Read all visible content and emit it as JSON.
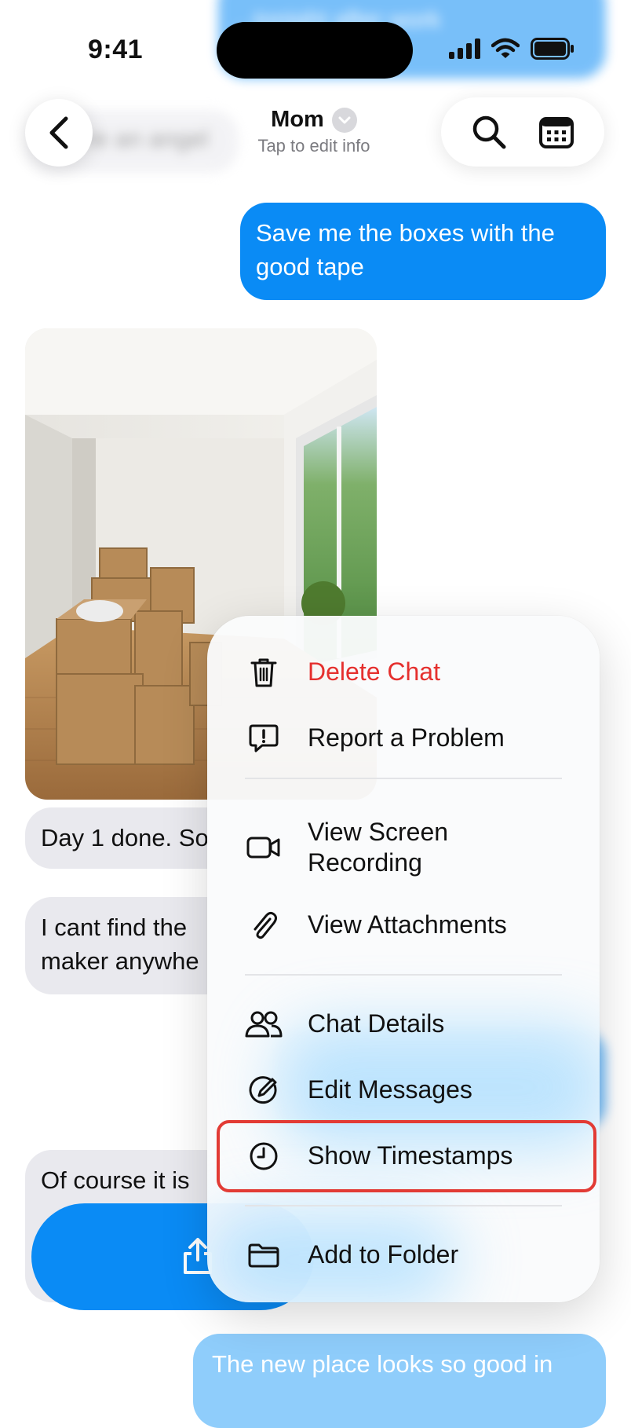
{
  "status_bar": {
    "time": "9:41"
  },
  "header": {
    "contact_name": "Mom",
    "subtitle": "Tap to edit info"
  },
  "messages": {
    "top_blurred": "...tonight after work",
    "angel": "You're an angel",
    "boxes": "Save me the boxes with the good tape",
    "day1": "Day 1 done. So",
    "cant_find_1": "I cant find the",
    "cant_find_2": "maker anywhe",
    "of_course": "Of course it is",
    "new_place": "The new place looks so good in"
  },
  "menu": {
    "items": [
      {
        "label": "Delete Chat",
        "icon": "trash-icon"
      },
      {
        "label": "Report a Problem",
        "icon": "report-bubble-icon"
      },
      {
        "label": "View Screen Recording",
        "icon": "video-camera-icon"
      },
      {
        "label": "View Attachments",
        "icon": "paperclip-icon"
      },
      {
        "label": "Chat Details",
        "icon": "people-icon"
      },
      {
        "label": "Edit Messages",
        "icon": "edit-circle-icon"
      },
      {
        "label": "Show Timestamps",
        "icon": "clock-icon"
      },
      {
        "label": "Add to Folder",
        "icon": "folder-icon"
      }
    ]
  },
  "colors": {
    "accent_blue": "#0a8bf5",
    "destructive_red": "#e5302e",
    "highlight_red": "#e23b35"
  }
}
